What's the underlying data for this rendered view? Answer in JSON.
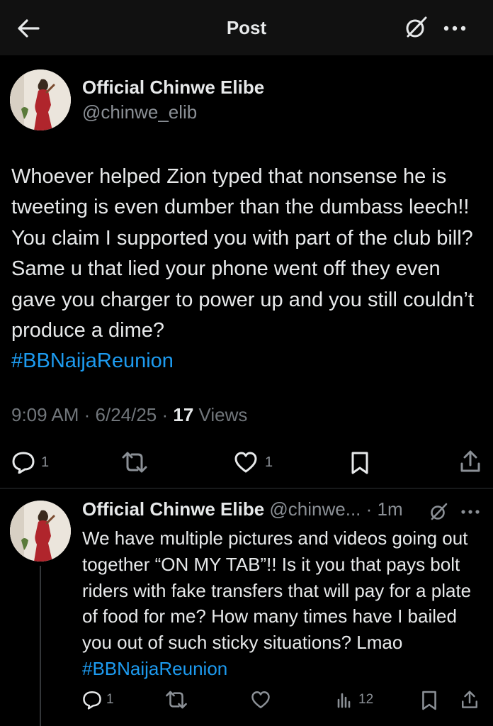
{
  "header": {
    "title": "Post",
    "back_icon": "arrow-left-icon",
    "grok_icon": "grok-icon",
    "more_icon": "more-icon"
  },
  "post": {
    "author_name": "Official Chinwe Elibe",
    "handle": "@chinwe_elib",
    "text": "Whoever helped Zion typed that nonsense he is tweeting is even dumber than the dumbass leech!! You claim I supported you with part of the club bill? Same u that lied your phone went off they even gave you charger to power up and you still couldn’t produce a dime?",
    "hashtag": "#BBNaijaReunion",
    "time": "9:09 AM",
    "date": "6/24/25",
    "views_count": "17",
    "views_label": "Views",
    "replies": "1",
    "likes": "1"
  },
  "reply": {
    "author_name": "Official Chinwe Elibe",
    "handle": "@chinwe...",
    "age": "1m",
    "text": "We have multiple pictures and videos going out together “ON MY TAB”!! Is it you that pays bolt riders with fake transfers that will pay for a plate of food for me? How many times have I bailed you out of such sticky situations? Lmao",
    "hashtag": "#BBNaijaReunion",
    "replies": "1",
    "views": "12"
  },
  "colors": {
    "background": "#000000",
    "header_bg": "#111111",
    "text": "#e7e9ea",
    "muted": "#71767b",
    "link": "#1d9bf0",
    "divider": "#2f3336"
  }
}
